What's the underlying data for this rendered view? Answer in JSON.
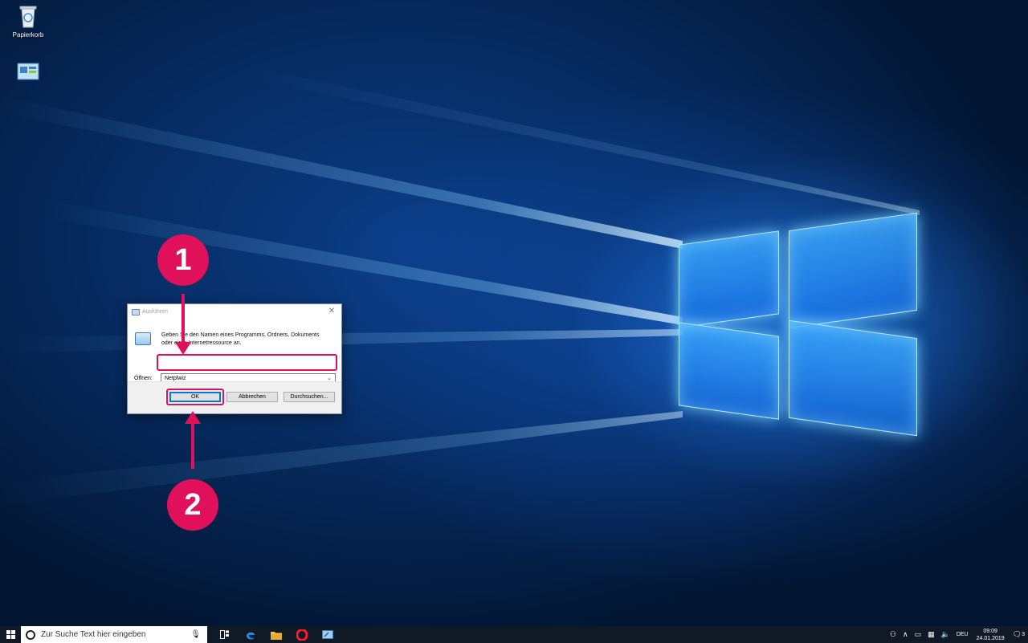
{
  "desktop": {
    "icons": [
      {
        "label": "Papierkorb",
        "icon": "recycle-bin-icon"
      },
      {
        "label": "",
        "icon": "control-panel-icon"
      }
    ]
  },
  "run_dialog": {
    "title": "Ausführen",
    "close_glyph": "✕",
    "description": "Geben Sie den Namen eines Programms, Ordners, Dokuments oder einer Internetressource an.",
    "open_label": "Öffnen:",
    "open_value": "Netplwiz",
    "ok_label": "OK",
    "cancel_label": "Abbrechen",
    "browse_label": "Durchsuchen..."
  },
  "annotations": {
    "step1": "1",
    "step2": "2",
    "accent_color": "#e0105a"
  },
  "taskbar": {
    "search_placeholder": "Zur Suche Text hier eingeben",
    "apps": [
      "task-view-icon",
      "edge-icon",
      "file-explorer-icon",
      "opera-icon",
      "run-icon"
    ],
    "language": "DEU",
    "time": "09:09",
    "date": "24.01.2019",
    "notification_count": "3"
  }
}
